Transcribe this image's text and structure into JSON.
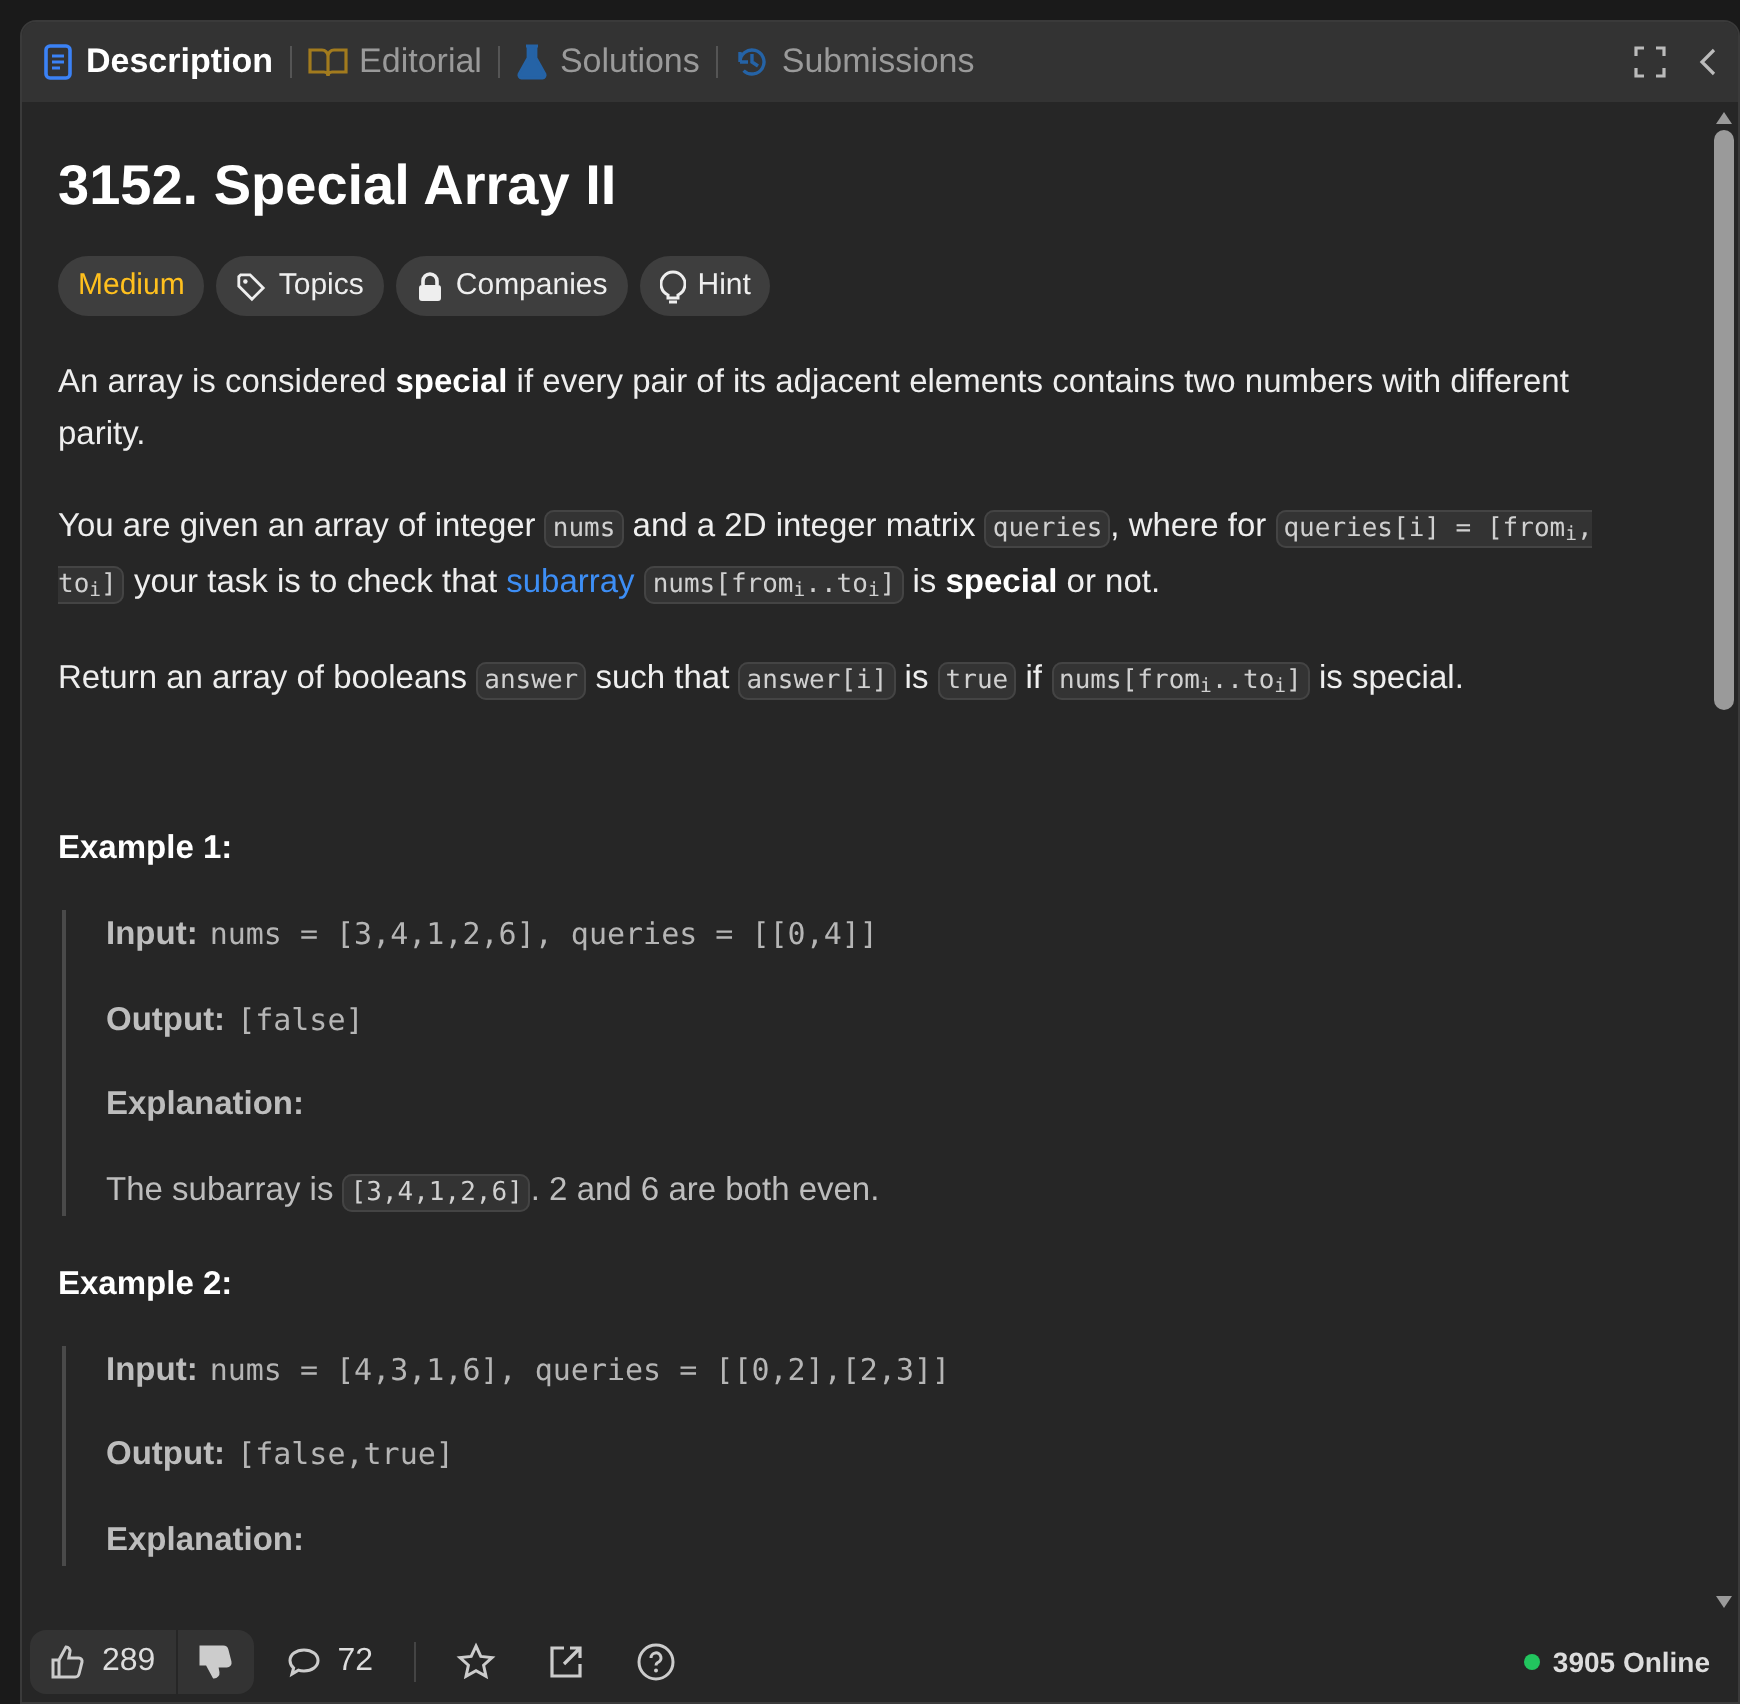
{
  "tabs": [
    {
      "label": "Description",
      "selected": true
    },
    {
      "label": "Editorial",
      "selected": false
    },
    {
      "label": "Solutions",
      "selected": false
    },
    {
      "label": "Submissions",
      "selected": false
    }
  ],
  "title": "3152. Special Array II",
  "tags": [
    {
      "label": "Medium",
      "kind": "difficulty"
    },
    {
      "label": "Topics",
      "kind": "tag"
    },
    {
      "label": "Companies",
      "kind": "lock"
    },
    {
      "label": "Hint",
      "kind": "bulb"
    }
  ],
  "paragraphs": [
    [
      {
        "kind": "text",
        "text": "An array is considered "
      },
      {
        "kind": "bold",
        "text": "special"
      },
      {
        "kind": "text",
        "text": " if every pair of its adjacent elements contains two numbers with different parity."
      }
    ],
    [
      {
        "kind": "text",
        "text": "You are given an array of integer "
      },
      {
        "kind": "code",
        "text": "nums"
      },
      {
        "kind": "text",
        "text": " and a 2D integer matrix "
      },
      {
        "kind": "code",
        "text": "queries"
      },
      {
        "kind": "text",
        "text": ", where for "
      },
      {
        "kind": "code",
        "text": "queries[i] = [from$_{i}$, to$_{i}$]"
      },
      {
        "kind": "text",
        "text": " your task is to check that "
      },
      {
        "kind": "link",
        "text": "subarray"
      },
      {
        "kind": "code",
        "text": "nums[from$_{i}$..to$_{i}$]"
      },
      {
        "kind": "text",
        "text": " is "
      },
      {
        "kind": "bold",
        "text": "special"
      },
      {
        "kind": "text",
        "text": " or not."
      }
    ],
    [
      {
        "kind": "text",
        "text": "Return an array of booleans "
      },
      {
        "kind": "code",
        "text": "answer"
      },
      {
        "kind": "text",
        "text": " such that "
      },
      {
        "kind": "code",
        "text": "answer[i]"
      },
      {
        "kind": "text",
        "text": " is "
      },
      {
        "kind": "code",
        "text": "true"
      },
      {
        "kind": "text",
        "text": " if "
      },
      {
        "kind": "code",
        "text": "nums[from$_{i}$..to$_{i}$]"
      },
      {
        "kind": "text",
        "text": " is special."
      }
    ]
  ],
  "examples": [
    {
      "heading": "Example 1:",
      "lines": [
        {
          "kind": "mono",
          "label": "Input:",
          "value": "nums = [3,4,1,2,6], queries = [[0,4]]"
        },
        {
          "kind": "mono",
          "label": "Output:",
          "value": "[false]"
        },
        {
          "kind": "heading",
          "label": "Explanation:"
        },
        {
          "kind": "prose",
          "segments": [
            {
              "kind": "text",
              "text": "The subarray is "
            },
            {
              "kind": "code",
              "text": "[3,4,1,2,6]"
            },
            {
              "kind": "text",
              "text": ". 2 and 6 are both even."
            }
          ]
        }
      ]
    },
    {
      "heading": "Example 2:",
      "lines": [
        {
          "kind": "mono",
          "label": "Input:",
          "value": "nums = [4,3,1,6], queries = [[0,2],[2,3]]"
        },
        {
          "kind": "mono",
          "label": "Output:",
          "value": "[false,true]"
        },
        {
          "kind": "heading",
          "label": "Explanation:"
        }
      ]
    }
  ],
  "footer": {
    "likes": "289",
    "comments": "72",
    "online": "3905 Online"
  }
}
